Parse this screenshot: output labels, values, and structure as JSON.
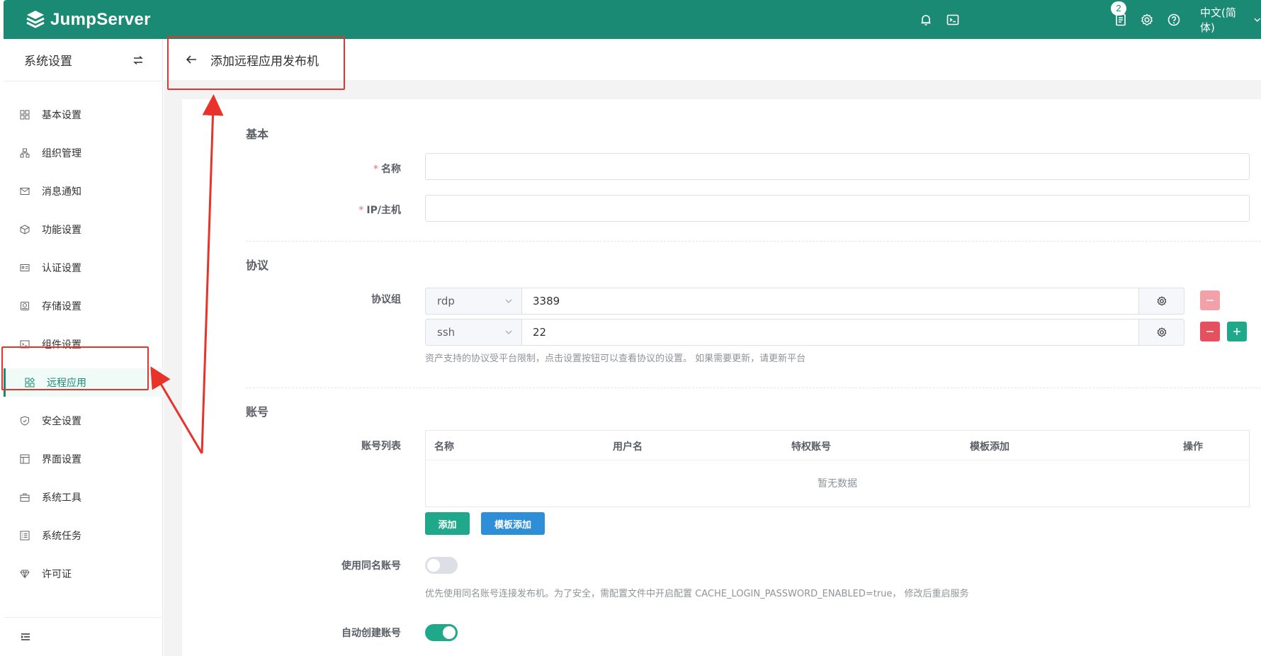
{
  "app": {
    "brand": "JumpServer",
    "task_badge": "2",
    "language": "中文(简体)"
  },
  "sidebar": {
    "title": "系统设置",
    "items": [
      {
        "label": "基本设置",
        "icon": "grid-icon"
      },
      {
        "label": "组织管理",
        "icon": "org-tree-icon"
      },
      {
        "label": "消息通知",
        "icon": "message-icon"
      },
      {
        "label": "功能设置",
        "icon": "cube-icon"
      },
      {
        "label": "认证设置",
        "icon": "id-card-icon"
      },
      {
        "label": "存储设置",
        "icon": "storage-icon"
      },
      {
        "label": "组件设置",
        "icon": "terminal-window-icon"
      },
      {
        "label": "远程应用",
        "icon": "apps-icon",
        "active": true
      },
      {
        "label": "安全设置",
        "icon": "shield-icon"
      },
      {
        "label": "界面设置",
        "icon": "layout-icon"
      },
      {
        "label": "系统工具",
        "icon": "toolbox-icon"
      },
      {
        "label": "系统任务",
        "icon": "task-list-icon"
      },
      {
        "label": "许可证",
        "icon": "license-icon"
      }
    ]
  },
  "page": {
    "title": "添加远程应用发布机"
  },
  "form": {
    "basic": {
      "section": "基本",
      "name_label": "名称",
      "name_value": "",
      "ip_label": "IP/主机",
      "ip_value": ""
    },
    "protocol": {
      "section": "协议",
      "group_label": "协议组",
      "rows": [
        {
          "protocol": "rdp",
          "port": "3389"
        },
        {
          "protocol": "ssh",
          "port": "22"
        }
      ],
      "help": "资产支持的协议受平台限制，点击设置按钮可以查看协议的设置。 如果需要更新，请更新平台"
    },
    "account": {
      "section": "账号",
      "list_label": "账号列表",
      "columns": [
        "名称",
        "用户名",
        "特权账号",
        "模板添加",
        "操作"
      ],
      "empty_text": "暂无数据",
      "add_button": "添加",
      "template_add_button": "模板添加",
      "same_name_label": "使用同名账号",
      "same_name_enabled": false,
      "same_name_help": "优先使用同名账号连接发布机。为了安全，需配置文件中开启配置 CACHE_LOGIN_PASSWORD_ENABLED=true， 修改后重启服务",
      "auto_create_label": "自动创建账号",
      "auto_create_enabled": true
    }
  },
  "colors": {
    "primary": "#1b8a74",
    "info": "#2e8fd8",
    "danger": "#e5505f",
    "danger_light": "#f3a1a9",
    "annotation": "#e8322a"
  }
}
